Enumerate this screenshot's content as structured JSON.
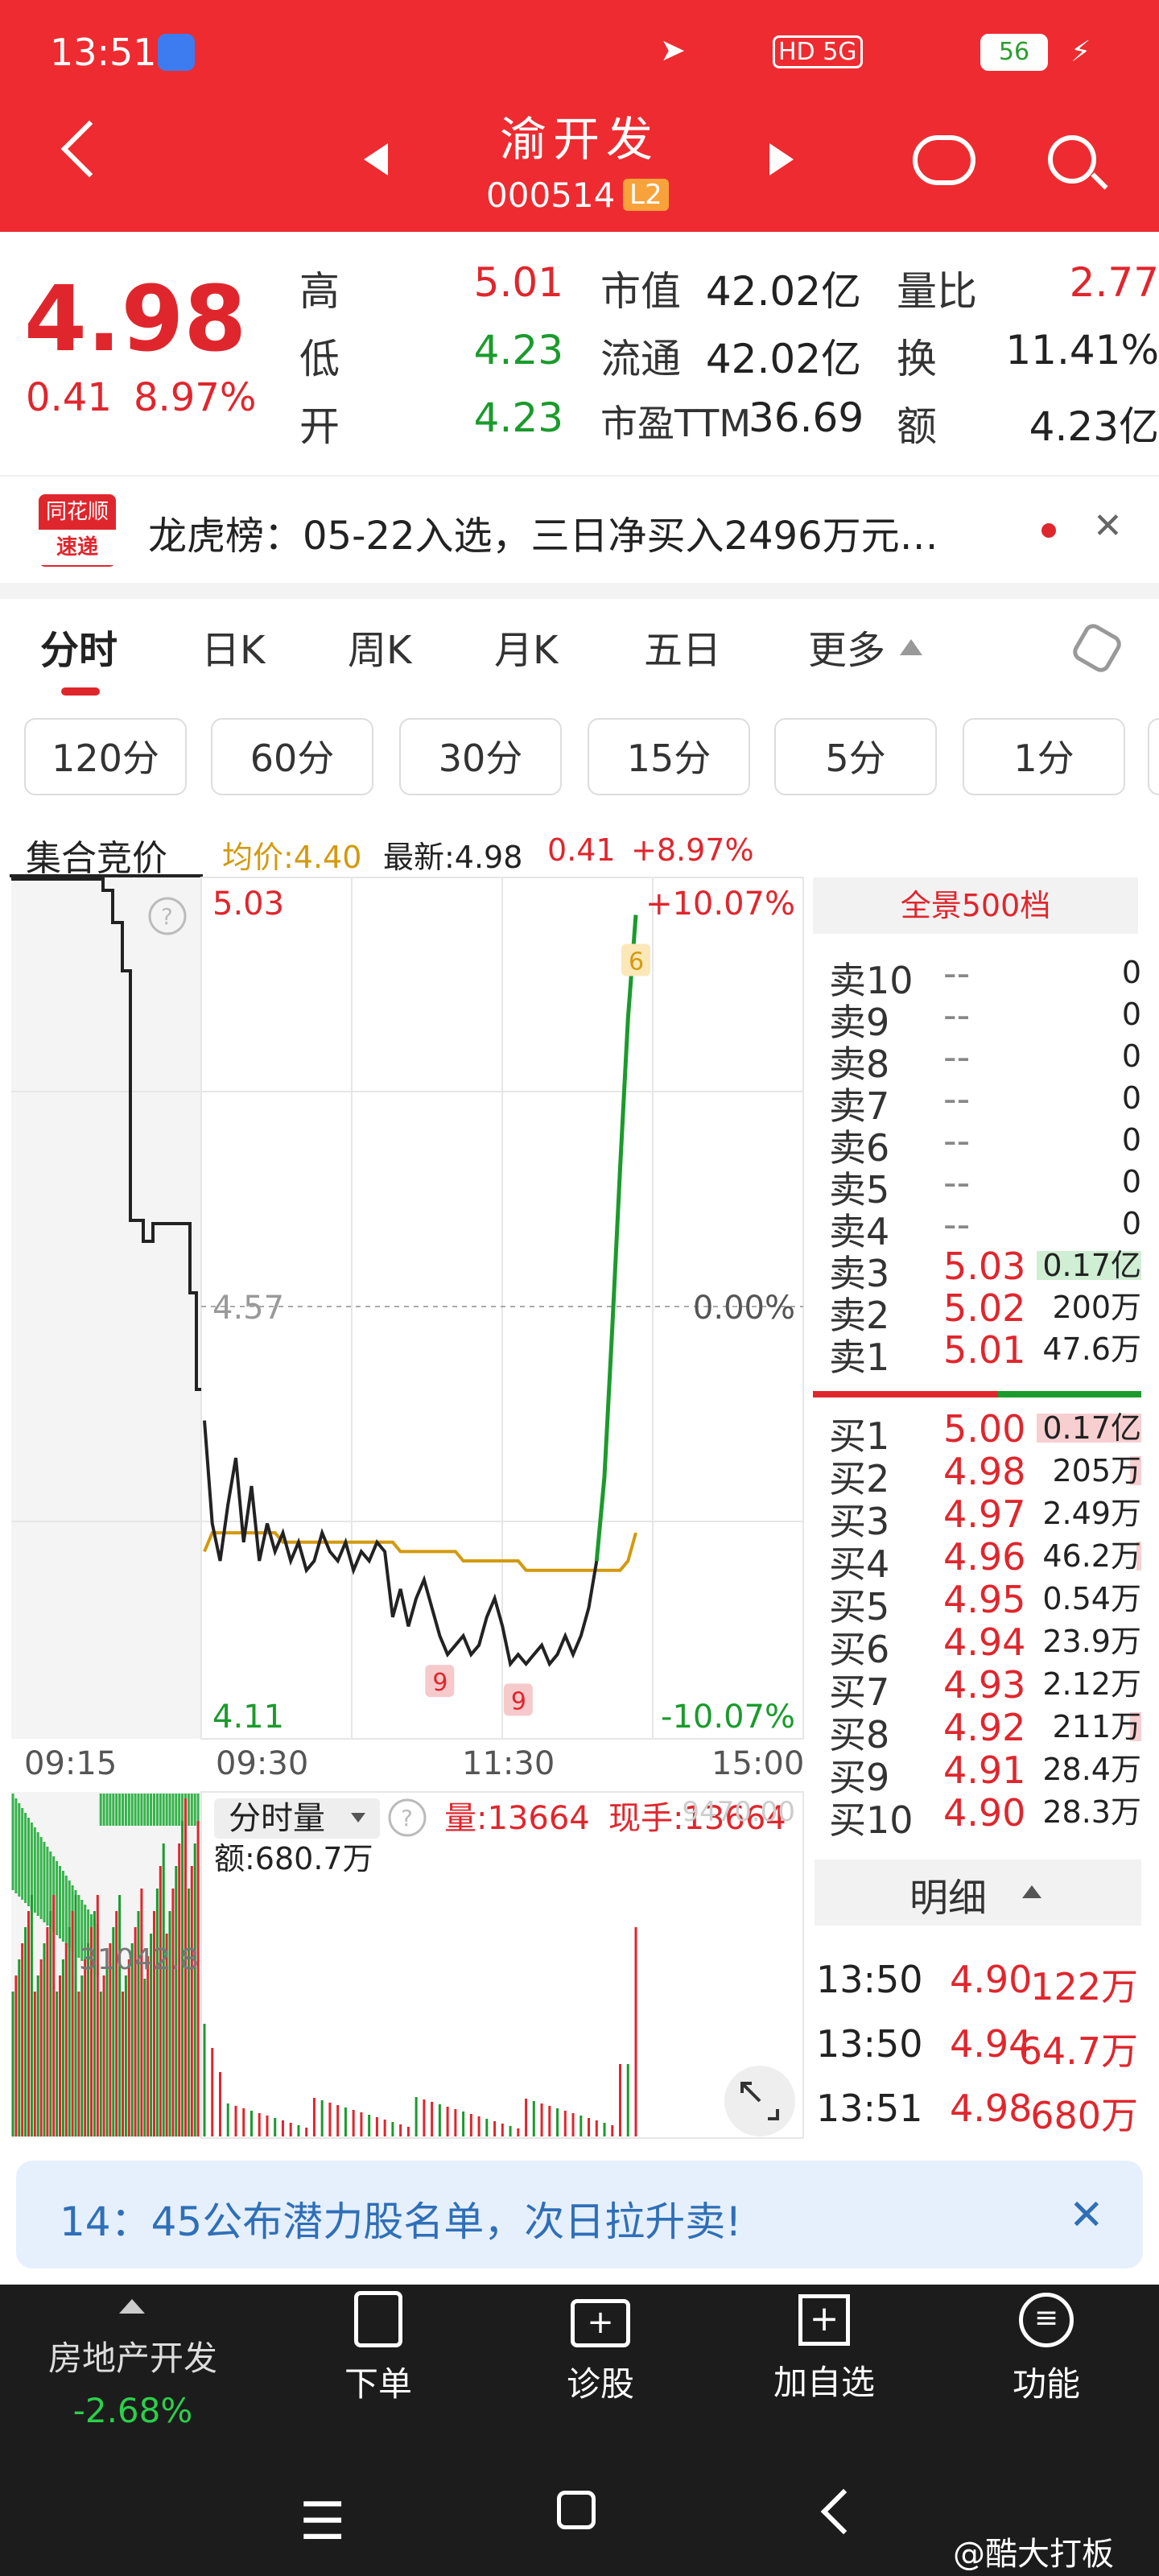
{
  "status_bar": {
    "time": "13:51",
    "network": "HD 5G",
    "battery": "56"
  },
  "header": {
    "stock_name": "渝开发",
    "stock_code": "000514",
    "level_badge": "L2"
  },
  "quote": {
    "price": "4.98",
    "change": "0.41",
    "change_pct": "8.97%",
    "stats": [
      {
        "label": "高",
        "value": "5.01"
      },
      {
        "label": "低",
        "value": "4.23"
      },
      {
        "label": "开",
        "value": "4.23"
      },
      {
        "label": "市值",
        "value": "42.02亿"
      },
      {
        "label": "流通",
        "value": "42.02亿"
      },
      {
        "label": "市盈TTM",
        "value": "36.69"
      },
      {
        "label": "量比",
        "value": "2.77"
      },
      {
        "label": "换",
        "value": "11.41%"
      },
      {
        "label": "额",
        "value": "4.23亿"
      }
    ]
  },
  "news": {
    "logo_top": "同花顺",
    "logo_bottom": "速递",
    "text": "龙虎榜：05-22入选，三日净买入2496万元…"
  },
  "tabs": [
    "分时",
    "日K",
    "周K",
    "月K",
    "五日",
    "更多"
  ],
  "period_pills": [
    "120分",
    "60分",
    "30分",
    "15分",
    "5分",
    "1分"
  ],
  "chart_header": {
    "auction_label": "集合竞价",
    "avg_label": "均价:4.40",
    "latest_label": "最新:4.98",
    "change": "0.41",
    "change_pct": "+8.97%"
  },
  "chart_data": {
    "type": "line",
    "price_axis": {
      "high": "5.03",
      "mid": "4.57",
      "low": "4.11"
    },
    "pct_axis": {
      "high": "+10.07%",
      "mid": "0.00%",
      "low": "-10.07%"
    },
    "time_labels": [
      "09:15",
      "09:30",
      "11:30",
      "15:00"
    ],
    "ylim": [
      4.11,
      5.03
    ],
    "price_series": [
      4.45,
      4.34,
      4.3,
      4.36,
      4.41,
      4.32,
      4.38,
      4.3,
      4.34,
      4.31,
      4.33,
      4.3,
      4.32,
      4.29,
      4.3,
      4.33,
      4.31,
      4.3,
      4.32,
      4.29,
      4.31,
      4.3,
      4.32,
      4.31,
      4.24,
      4.27,
      4.23,
      4.26,
      4.28,
      4.25,
      4.22,
      4.2,
      4.21,
      4.22,
      4.2,
      4.21,
      4.24,
      4.26,
      4.23,
      4.19,
      4.2,
      4.19,
      4.2,
      4.21,
      4.19,
      4.2,
      4.22,
      4.2,
      4.22,
      4.25,
      4.3,
      4.39,
      4.55,
      4.72,
      4.88,
      4.99
    ],
    "avg_series": [
      4.31,
      4.33,
      4.33,
      4.33,
      4.33,
      4.33,
      4.33,
      4.33,
      4.33,
      4.33,
      4.32,
      4.32,
      4.32,
      4.32,
      4.32,
      4.32,
      4.32,
      4.32,
      4.32,
      4.32,
      4.32,
      4.32,
      4.32,
      4.32,
      4.32,
      4.31,
      4.31,
      4.31,
      4.31,
      4.31,
      4.31,
      4.31,
      4.31,
      4.3,
      4.3,
      4.3,
      4.3,
      4.3,
      4.3,
      4.3,
      4.3,
      4.29,
      4.29,
      4.29,
      4.29,
      4.29,
      4.29,
      4.29,
      4.29,
      4.29,
      4.29,
      4.29,
      4.29,
      4.29,
      4.3,
      4.33
    ],
    "markers": [
      "9",
      "9",
      "6"
    ]
  },
  "volume": {
    "title": "分时量",
    "vol_label": "量:13664",
    "now_label": "现手:13664",
    "amount_label": "额:680.7万",
    "left_axis": "31042.8",
    "right_axis": "9470.00"
  },
  "orderbook": {
    "header": "全景500档",
    "asks": [
      {
        "label": "卖10",
        "price": "--",
        "vol": "0"
      },
      {
        "label": "卖9",
        "price": "--",
        "vol": "0"
      },
      {
        "label": "卖8",
        "price": "--",
        "vol": "0"
      },
      {
        "label": "卖7",
        "price": "--",
        "vol": "0"
      },
      {
        "label": "卖6",
        "price": "--",
        "vol": "0"
      },
      {
        "label": "卖5",
        "price": "--",
        "vol": "0"
      },
      {
        "label": "卖4",
        "price": "--",
        "vol": "0"
      },
      {
        "label": "卖3",
        "price": "5.03",
        "vol": "0.17亿"
      },
      {
        "label": "卖2",
        "price": "5.02",
        "vol": "200万"
      },
      {
        "label": "卖1",
        "price": "5.01",
        "vol": "47.6万"
      }
    ],
    "bids": [
      {
        "label": "买1",
        "price": "5.00",
        "vol": "0.17亿"
      },
      {
        "label": "买2",
        "price": "4.98",
        "vol": "205万"
      },
      {
        "label": "买3",
        "price": "4.97",
        "vol": "2.49万"
      },
      {
        "label": "买4",
        "price": "4.96",
        "vol": "46.2万"
      },
      {
        "label": "买5",
        "price": "4.95",
        "vol": "0.54万"
      },
      {
        "label": "买6",
        "price": "4.94",
        "vol": "23.9万"
      },
      {
        "label": "买7",
        "price": "4.93",
        "vol": "2.12万"
      },
      {
        "label": "买8",
        "price": "4.92",
        "vol": "211万"
      },
      {
        "label": "买9",
        "price": "4.91",
        "vol": "28.4万"
      },
      {
        "label": "买10",
        "price": "4.90",
        "vol": "28.3万"
      }
    ],
    "detail_header": "明细",
    "details": [
      {
        "time": "13:50",
        "price": "4.90",
        "amount": "122万"
      },
      {
        "time": "13:50",
        "price": "4.94",
        "amount": "64.7万"
      },
      {
        "time": "13:51",
        "price": "4.98",
        "amount": "680万"
      }
    ]
  },
  "banner": {
    "text": "14：45公布潜力股名单，次日拉升卖!"
  },
  "bottom_nav": {
    "sector_name": "房地产开发",
    "sector_change": "-2.68%",
    "items": [
      "下单",
      "诊股",
      "加自选",
      "功能"
    ]
  },
  "watermark": "@酷大打板",
  "colors": {
    "header_red": "#ee2b30",
    "up_red": "#e0262d",
    "down_green": "#1a9b2c",
    "avg_gold": "#d39a0e"
  }
}
